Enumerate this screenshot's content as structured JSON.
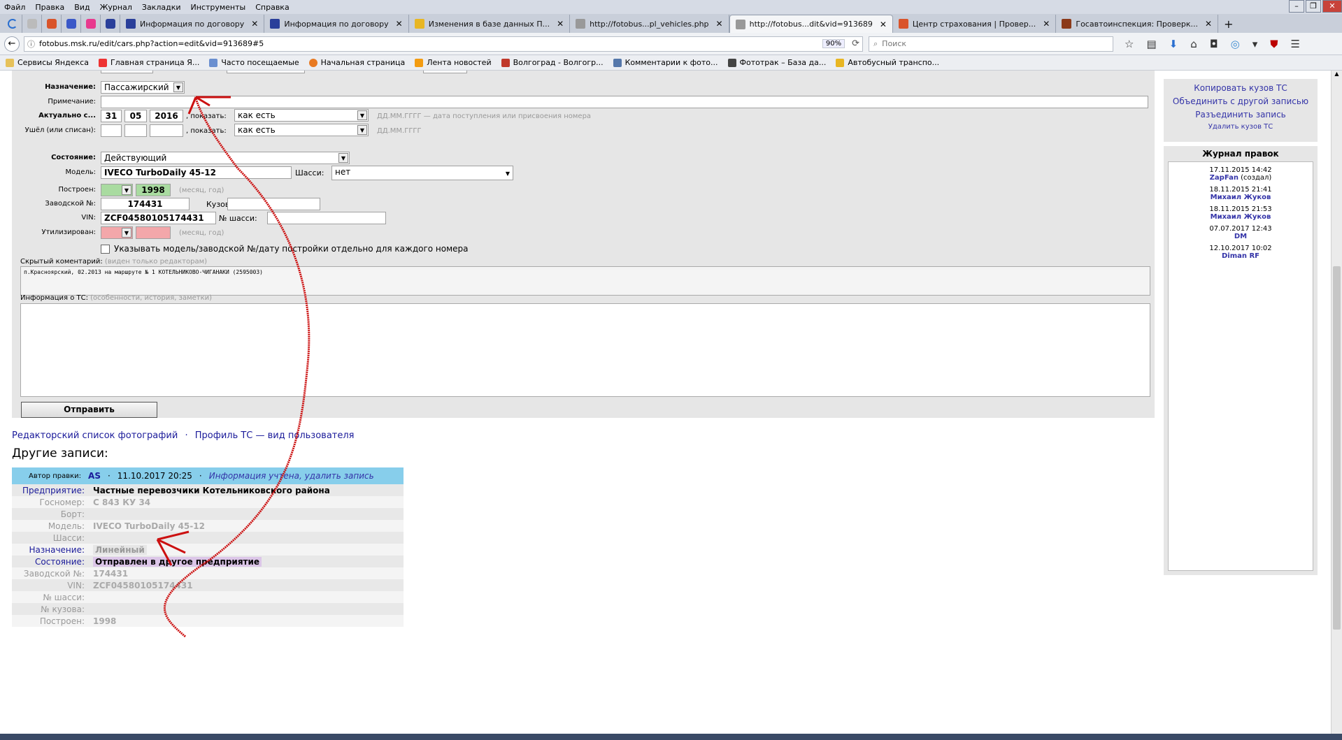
{
  "menu": [
    "Файл",
    "Правка",
    "Вид",
    "Журнал",
    "Закладки",
    "Инструменты",
    "Справка"
  ],
  "tabs": [
    {
      "label": "Информация по договору",
      "color": "#2a3f9a"
    },
    {
      "label": "Информация по договору",
      "color": "#2a3f9a"
    },
    {
      "label": "Изменения в базе данных П...",
      "color": "#e8b623"
    },
    {
      "label": "http://fotobus...pl_vehicles.php",
      "color": "#999999"
    },
    {
      "label": "http://fotobus...dit&vid=913689",
      "color": "#999999",
      "active": true
    },
    {
      "label": "Центр страхования | Провер...",
      "color": "#d9542b"
    },
    {
      "label": "Госавтоинспекция: Проверк...",
      "color": "#8b3a1a"
    }
  ],
  "url": "fotobus.msk.ru/edit/cars.php?action=edit&vid=913689#5",
  "zoom": "90%",
  "search_placeholder": "Поиск",
  "bookmarks": [
    "Сервисы Яндекса",
    "Главная страница Я...",
    "Часто посещаемые",
    "Начальная страница",
    "Лента новостей",
    "Волгоград - Волгогр...",
    "Комментарии к фото...",
    "Фототрак – База да...",
    "Автобусный транспо..."
  ],
  "form": {
    "purpose_label": "Назначение:",
    "purpose_value": "Пассажирский",
    "note_label": "Примечание:",
    "actual_label": "Актуально с...",
    "actual_day": "31",
    "actual_month": "05",
    "actual_year": "2016",
    "show_label": ", показать:",
    "show_value": "как есть",
    "date_hint1": "ДД.ММ.ГГГГ — дата поступления или присвоения номера",
    "left_label": "Ушёл (или списан):",
    "date_hint2": "ДД.ММ.ГГГГ",
    "state_label": "Состояние:",
    "state_value": "Действующий",
    "model_label": "Модель:",
    "model_value": "IVECO TurboDaily 45-12",
    "chassis_label": "Шасси:",
    "chassis_value": "нет",
    "built_label": "Построен:",
    "built_year": "1998",
    "month_year_hint": "(месяц, год)",
    "factory_label": "Заводской №:",
    "factory_value": "174431",
    "body_label": "Кузов:",
    "vin_label": "VIN:",
    "vin_value": "ZCF04580105174431",
    "chassis_no_label": "№ шасси:",
    "utilized_label": "Утилизирован:",
    "per_number_checkbox": "Указывать модель/заводской №/дату постройки отдельно для каждого номера",
    "hidden_comment_label": "Скрытый коментарий:",
    "hidden_comment_hint": "(виден только редакторам)",
    "hidden_comment_value": "п.Красноярский, 02.2013 на маршруте № 1 КОТЕЛЬНИКОВО-ЧИГАНАКИ (2595003)",
    "info_label": "Информация о ТС:",
    "info_hint": "(особенности, история, заметки)",
    "submit": "Отправить"
  },
  "sidebar": {
    "links": [
      "Копировать кузов ТС",
      "Объединить с другой записью",
      "Разъединить запись",
      "Удалить кузов ТС"
    ],
    "journal_title": "Журнал правок",
    "journal": [
      {
        "date": "17.11.2015 14:42",
        "user": "ZapFan",
        "note": "(создал)"
      },
      {
        "date": "18.11.2015 21:41",
        "user": "Михаил Жуков",
        "note": ""
      },
      {
        "date": "18.11.2015 21:53",
        "user": "Михаил Жуков",
        "note": ""
      },
      {
        "date": "07.07.2017 12:43",
        "user": "DM",
        "note": ""
      },
      {
        "date": "12.10.2017 10:02",
        "user": "Diman RF",
        "note": ""
      }
    ]
  },
  "bottom_links": {
    "photos": "Редакторский список фотографий",
    "sep": "·",
    "profile": "Профиль ТС — вид пользователя"
  },
  "other_records_title": "Другие записи:",
  "record": {
    "author_label": "Автор правки:",
    "author": "AS",
    "date": "11.10.2017 20:25",
    "status_link": "Информация учтена, удалить запись",
    "rows": [
      {
        "k": "Предприятие:",
        "v": "Частные перевозчики Котельниковского района",
        "active": true
      },
      {
        "k": "Госномер:",
        "v": "С 843 КУ 34",
        "active": false
      },
      {
        "k": "Борт:",
        "v": "",
        "active": false
      },
      {
        "k": "Модель:",
        "v": "IVECO TurboDaily 45-12",
        "active": false
      },
      {
        "k": "Шасси:",
        "v": "",
        "active": false
      },
      {
        "k": "Назначение:",
        "v": "Линейный",
        "active": true
      },
      {
        "k": "Состояние:",
        "v": "Отправлен в другое предприятие",
        "active": true
      },
      {
        "k": "Заводской №:",
        "v": "174431",
        "active": false
      },
      {
        "k": "VIN:",
        "v": "ZCF04580105174431",
        "active": false
      },
      {
        "k": "№ шасси:",
        "v": "",
        "active": false
      },
      {
        "k": "№ кузова:",
        "v": "",
        "active": false
      },
      {
        "k": "Построен:",
        "v": "1998",
        "active": false
      }
    ]
  },
  "colors": {
    "accent_link": "#3434a8",
    "record_header": "#87ceeb",
    "arrow": "#cc1111",
    "built_green": "#a9dba0",
    "util_pink": "#f3a7aa"
  }
}
